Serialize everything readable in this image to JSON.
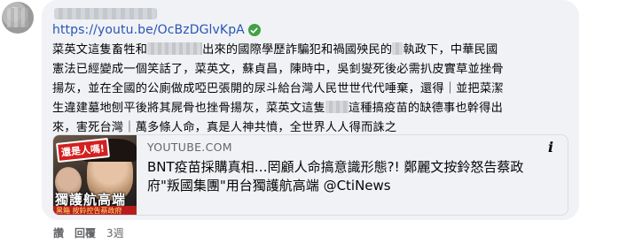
{
  "comment": {
    "link": "https://youtu.be/OcBzDGlvKpA",
    "line1_a": "菜英文這隻畜牲和",
    "line1_b": "出來的國際學歷詐騙犯和禍國殃民的",
    "line1_c": "執政下，中華民國",
    "line2": "憲法已經變成一個笑話了，菜英文，蘇貞昌，陳時中，吳釗燮死後必需扒皮實草並挫骨",
    "line3": "揚灰，並在全國的公廁做成啞巴張開的尿斗給台灣人民世世代代唾棄，還得｜並把菜潔",
    "line4_a": "生違建墓地刨平後將其屍骨也挫骨揚灰，菜英文這隻",
    "line4_b": "這種搞疫苗的缺德事也幹得出",
    "line5": "來，害死台灣｜萬多條人命，真是人神共憤，全世界人人得而誅之"
  },
  "preview": {
    "domain": "YOUTUBE.COM",
    "title": "BNT疫苗採購真相…罔顧人命搞意識形態?! 鄭麗文按鈴怒告蔡政府\"叛國集團\"用台獨護航高端 @CtiNews",
    "thumb_badge": "還是人嗎!",
    "thumb_caption": "獨護航高端",
    "thumb_strip": "黑箱 按鈴控告蔡政府"
  },
  "actions": {
    "like": "讚",
    "reply": "回覆",
    "time": "3週"
  },
  "colors": {
    "link": "#2a55b6",
    "bubble": "#f0f2f5",
    "verified": "#43a047"
  }
}
